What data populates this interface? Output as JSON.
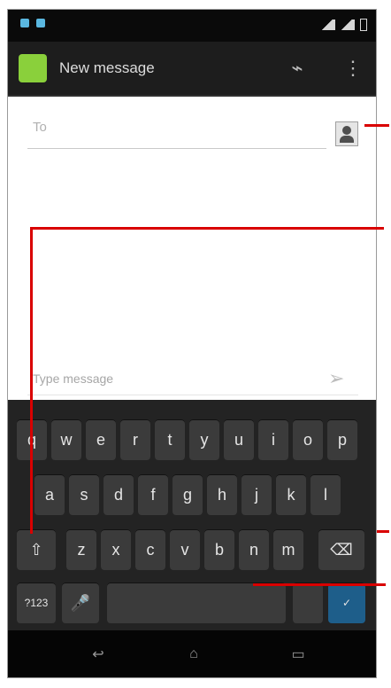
{
  "status_bar": {
    "icons": [
      "notification-icon",
      "signal-icon",
      "wifi-icon",
      "battery-icon"
    ]
  },
  "action_bar": {
    "title": "New message",
    "app_icon": "messaging-app-icon",
    "attach_icon": "paperclip-icon",
    "menu_icon": "overflow-menu-icon"
  },
  "compose": {
    "to_placeholder": "To",
    "message_placeholder": "Type message"
  },
  "keyboard": {
    "row1": [
      "q",
      "w",
      "e",
      "r",
      "t",
      "y",
      "u",
      "i",
      "o",
      "p"
    ],
    "row2": [
      "a",
      "s",
      "d",
      "f",
      "g",
      "h",
      "j",
      "k",
      "l"
    ],
    "row3": [
      "z",
      "x",
      "c",
      "v",
      "b",
      "n",
      "m"
    ],
    "sym_label": "?123"
  },
  "colors": {
    "action_bar": "#1d1d1d",
    "keyboard_bg": "#232323",
    "key": "#3b3b3b",
    "accent": "#33b5e5",
    "callout": "#d90000"
  }
}
